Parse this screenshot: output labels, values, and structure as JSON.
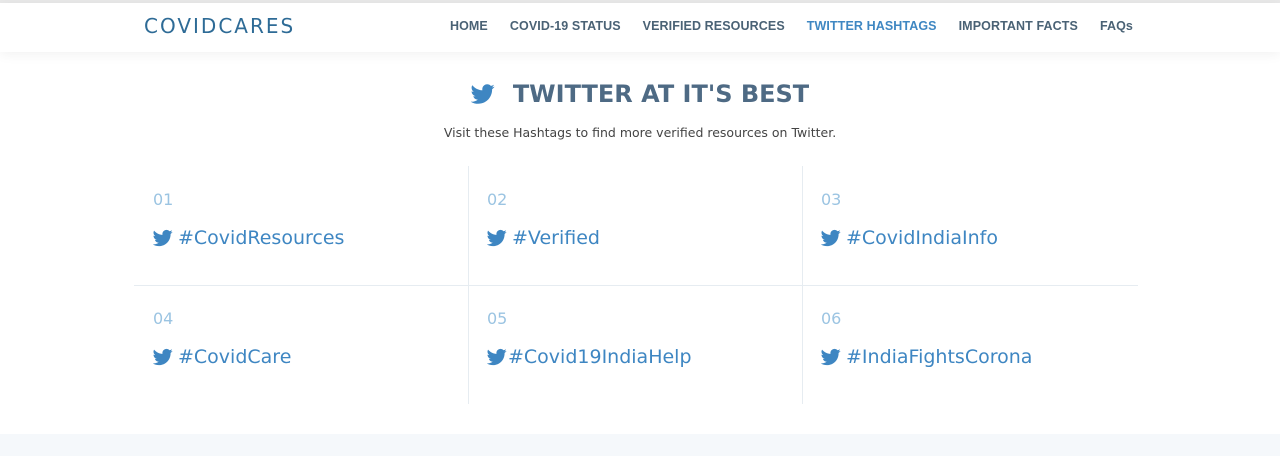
{
  "navbar": {
    "brand": "COVIDCARES",
    "items": [
      {
        "label": "HOME",
        "active": false
      },
      {
        "label": "COVID-19 STATUS",
        "active": false
      },
      {
        "label": "VERIFIED RESOURCES",
        "active": false
      },
      {
        "label": "TWITTER HASHTAGS",
        "active": true
      },
      {
        "label": "IMPORTANT FACTS",
        "active": false
      },
      {
        "label": "FAQs",
        "active": false
      }
    ]
  },
  "section": {
    "icon": "twitter-icon",
    "title": "TWITTER AT IT'S BEST",
    "subtitle": "Visit these Hashtags to find more verified resources on Twitter."
  },
  "hashtags": [
    {
      "number": "01",
      "tag": "#CovidResources"
    },
    {
      "number": "02",
      "tag": "#Verified"
    },
    {
      "number": "03",
      "tag": "#CovidIndiaInfo"
    },
    {
      "number": "04",
      "tag": "#CovidCare"
    },
    {
      "number": "05",
      "tag": "#Covid19IndiaHelp"
    },
    {
      "number": "06",
      "tag": "#IndiaFightsCorona"
    }
  ],
  "colors": {
    "brand": "#2e6b96",
    "nav_text": "#4a6275",
    "nav_active": "#3f87c2",
    "title": "#4e6a84",
    "twitter_blue": "#3e86c2",
    "number": "#9bc4e2"
  }
}
